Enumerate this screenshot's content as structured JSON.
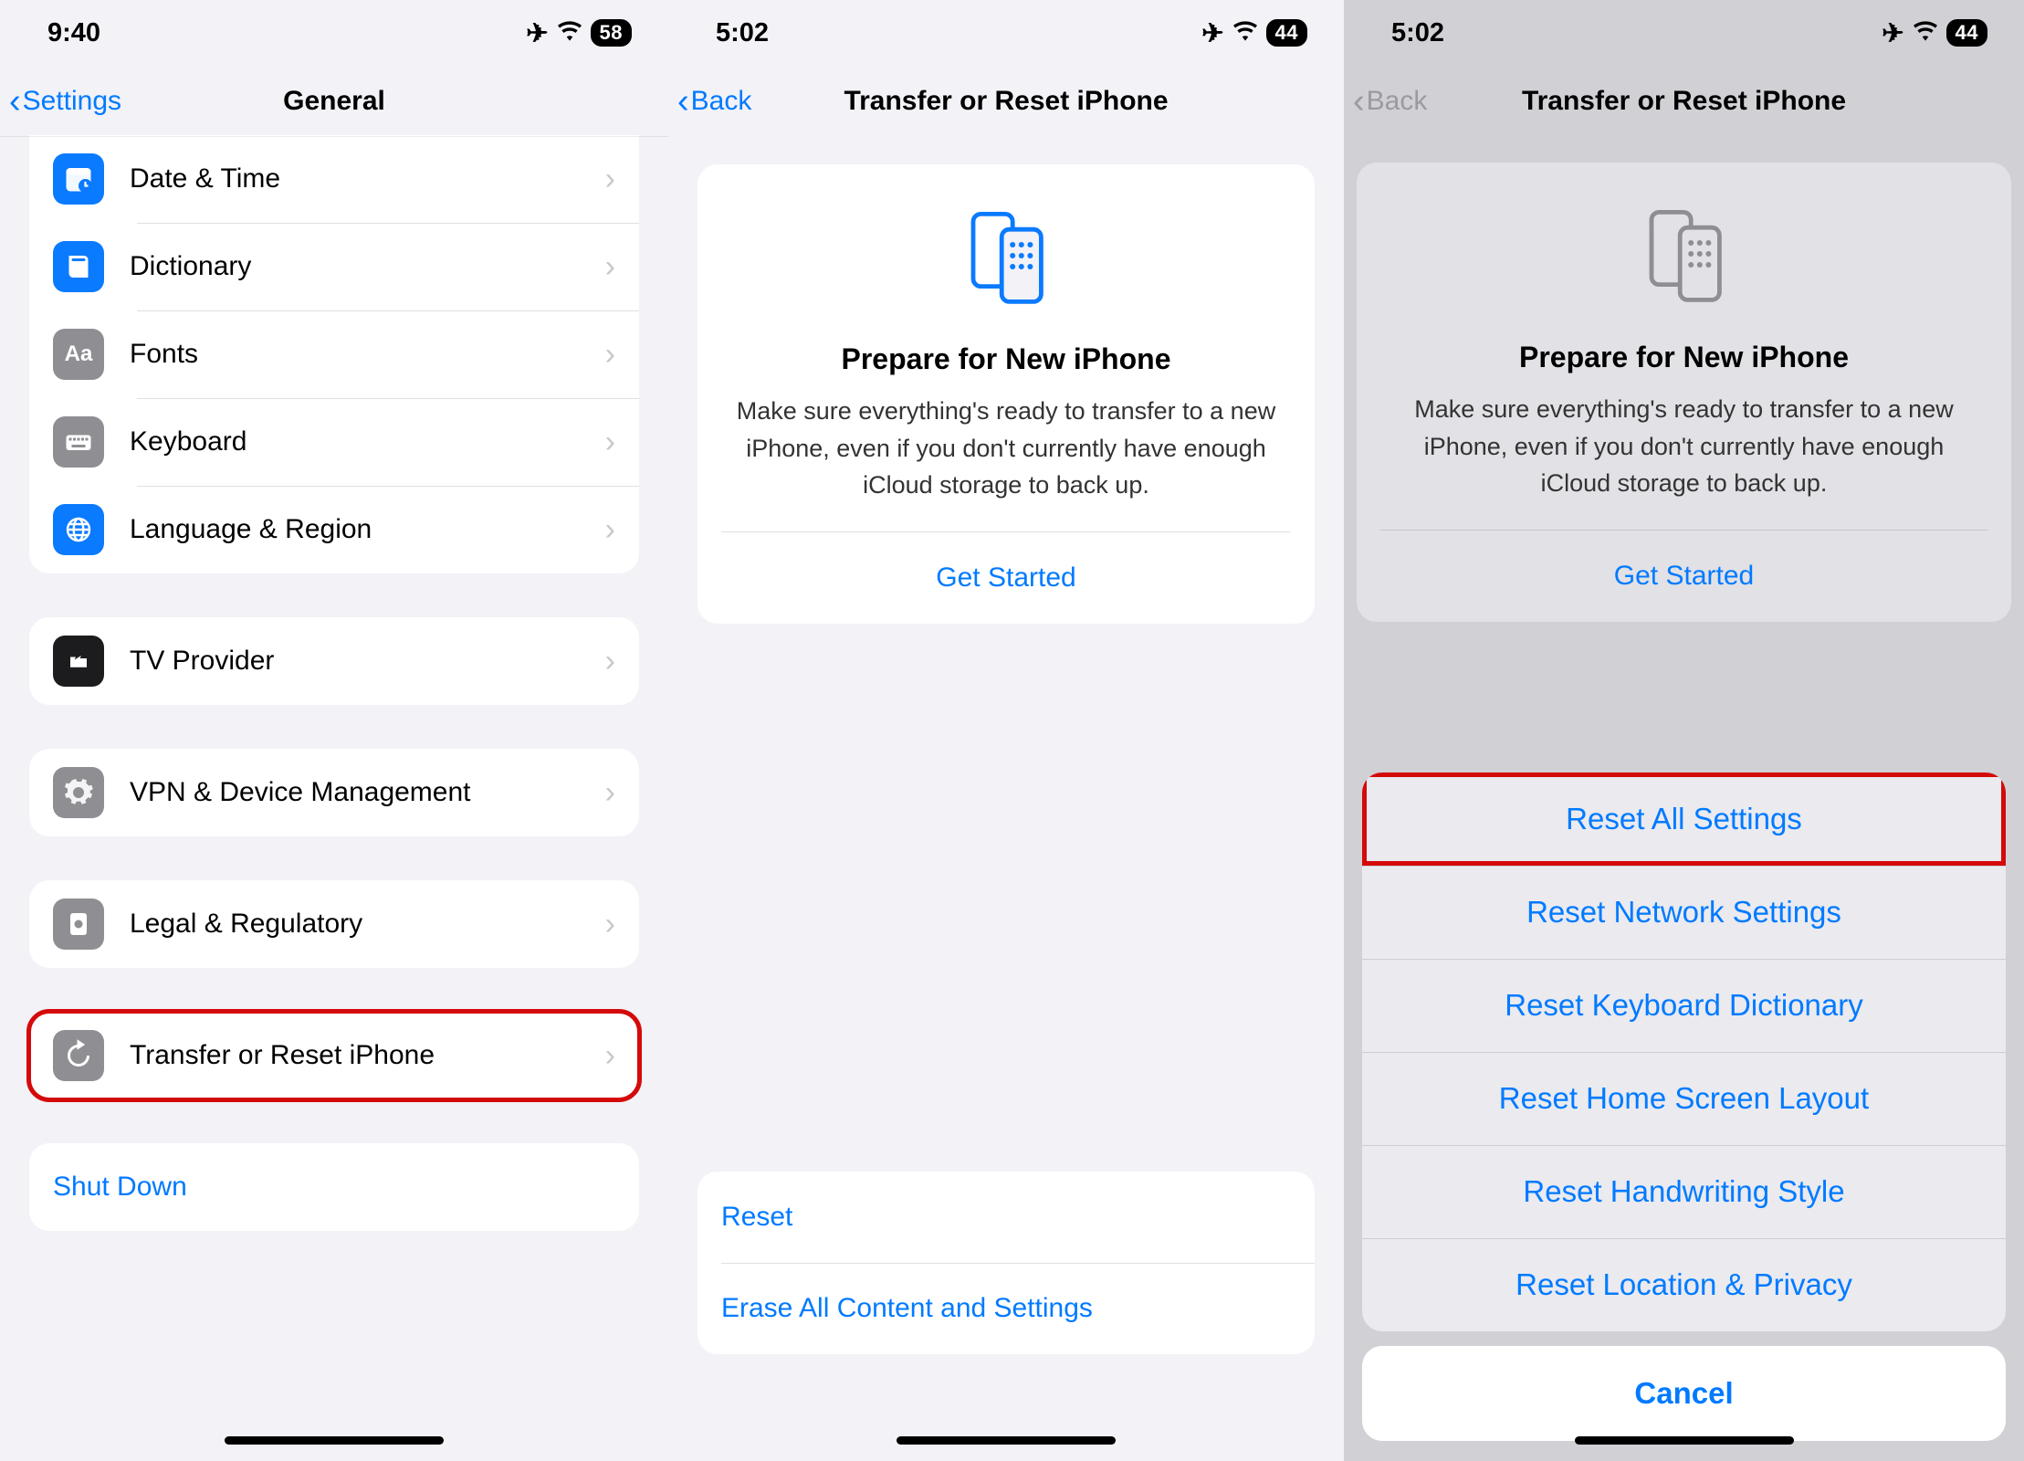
{
  "screen1": {
    "status": {
      "time": "9:40",
      "battery": "58"
    },
    "nav": {
      "back": "Settings",
      "title": "General"
    },
    "group1": [
      {
        "key": "date-time",
        "label": "Date & Time",
        "icon": "clock",
        "color": "ic-blue"
      },
      {
        "key": "dictionary",
        "label": "Dictionary",
        "icon": "book",
        "color": "ic-blue"
      },
      {
        "key": "fonts",
        "label": "Fonts",
        "icon": "aa",
        "color": "ic-gray"
      },
      {
        "key": "keyboard",
        "label": "Keyboard",
        "icon": "keyboard",
        "color": "ic-gray"
      },
      {
        "key": "lang",
        "label": "Language & Region",
        "icon": "globe",
        "color": "ic-blue"
      }
    ],
    "group2": [
      {
        "key": "tv",
        "label": "TV Provider",
        "icon": "tv",
        "color": "ic-dark"
      }
    ],
    "group3": [
      {
        "key": "vpn",
        "label": "VPN & Device Management",
        "icon": "gear",
        "color": "ic-gray"
      }
    ],
    "group4": [
      {
        "key": "legal",
        "label": "Legal & Regulatory",
        "icon": "cert",
        "color": "ic-gray"
      }
    ],
    "group5": [
      {
        "key": "reset",
        "label": "Transfer or Reset iPhone",
        "icon": "reset",
        "color": "ic-gray"
      }
    ],
    "shutdown": "Shut Down"
  },
  "screen2": {
    "status": {
      "time": "5:02",
      "battery": "44"
    },
    "nav": {
      "back": "Back",
      "title": "Transfer or Reset iPhone"
    },
    "card": {
      "title": "Prepare for New iPhone",
      "text": "Make sure everything's ready to transfer to a new iPhone, even if you don't currently have enough iCloud storage to back up.",
      "cta": "Get Started"
    },
    "actions": {
      "reset": "Reset",
      "erase": "Erase All Content and Settings"
    }
  },
  "screen3": {
    "status": {
      "time": "5:02",
      "battery": "44"
    },
    "nav": {
      "back": "Back",
      "title": "Transfer or Reset iPhone"
    },
    "card": {
      "title": "Prepare for New iPhone",
      "text": "Make sure everything's ready to transfer to a new iPhone, even if you don't currently have enough iCloud storage to back up.",
      "cta": "Get Started"
    },
    "sheet": {
      "options": [
        "Reset All Settings",
        "Reset Network Settings",
        "Reset Keyboard Dictionary",
        "Reset Home Screen Layout",
        "Reset Handwriting Style",
        "Reset Location & Privacy"
      ],
      "cancel": "Cancel"
    }
  }
}
